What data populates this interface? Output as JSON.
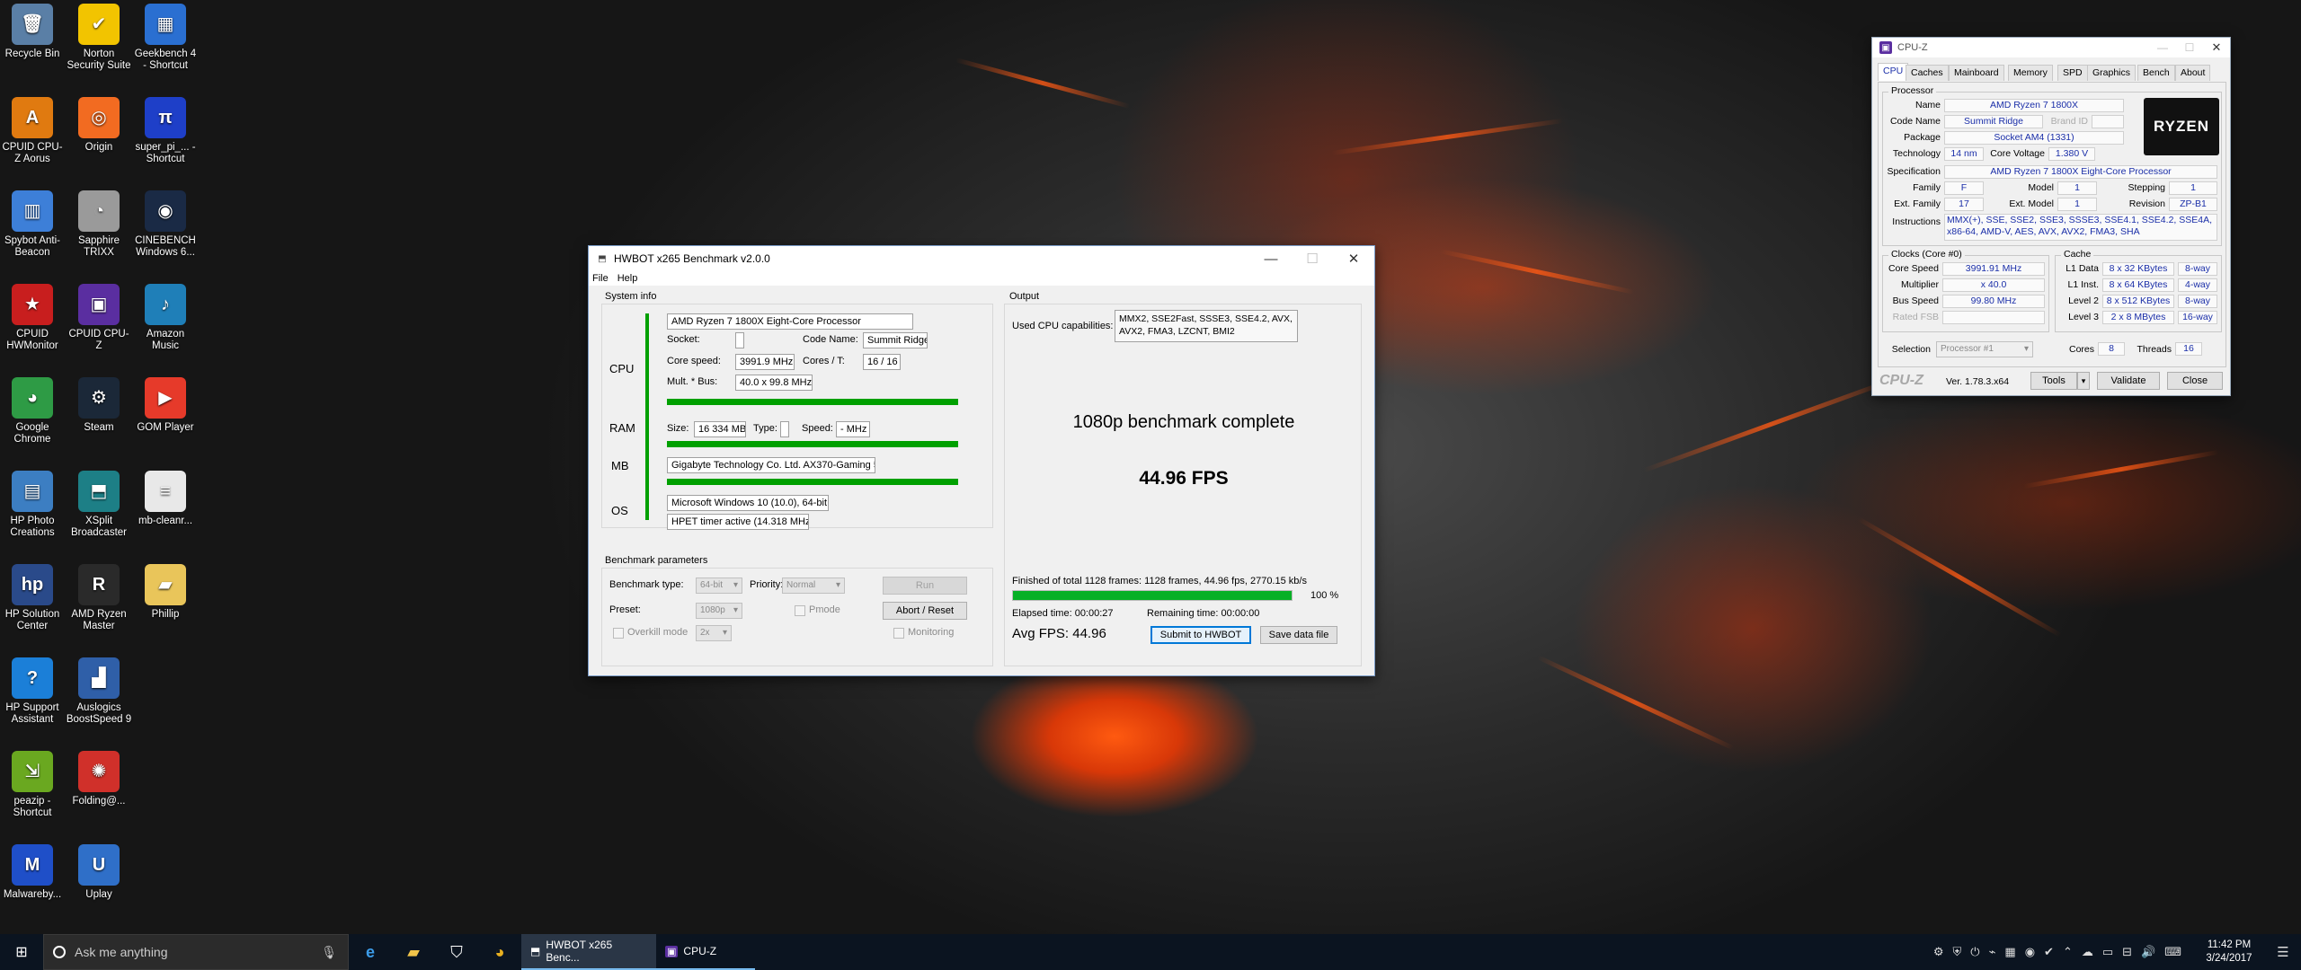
{
  "desktop": {
    "icons": [
      {
        "label": "Recycle Bin",
        "color": "#5a7fa6",
        "glyph": "🗑"
      },
      {
        "label": "Norton Security Suite",
        "color": "#f2c400",
        "glyph": "✔"
      },
      {
        "label": "Geekbench 4 - Shortcut",
        "color": "#2a6fd1",
        "glyph": "▦"
      },
      {
        "label": "CPUID CPU-Z Aorus",
        "color": "#e07a10",
        "glyph": "A"
      },
      {
        "label": "Origin",
        "color": "#f26b21",
        "glyph": "◎"
      },
      {
        "label": "super_pi_... - Shortcut",
        "color": "#1e3fc8",
        "glyph": "π"
      },
      {
        "label": "Spybot Anti-Beacon",
        "color": "#3d7fd8",
        "glyph": "▥"
      },
      {
        "label": "Sapphire TRIXX",
        "color": "#9a9a9a",
        "glyph": "◔"
      },
      {
        "label": "CINEBENCH Windows 6...",
        "color": "#1a2a45",
        "glyph": "◉"
      },
      {
        "label": "CPUID HWMonitor",
        "color": "#c81e1e",
        "glyph": "★"
      },
      {
        "label": "CPUID CPU-Z",
        "color": "#5a2ea0",
        "glyph": "▣"
      },
      {
        "label": "Amazon Music",
        "color": "#1f7fb8",
        "glyph": "♪"
      },
      {
        "label": "Google Chrome",
        "color": "#2e9b45",
        "glyph": "◕"
      },
      {
        "label": "Steam",
        "color": "#1b2838",
        "glyph": "⚙"
      },
      {
        "label": "GOM Player",
        "color": "#e63a2a",
        "glyph": "▶"
      },
      {
        "label": "HP Photo Creations",
        "color": "#3c7ec2",
        "glyph": "▤"
      },
      {
        "label": "XSplit Broadcaster",
        "color": "#1d7f86",
        "glyph": "⬒"
      },
      {
        "label": "mb-cleanr...",
        "color": "#e8e8e8",
        "glyph": "≡"
      },
      {
        "label": "HP Solution Center",
        "color": "#2a4a8a",
        "glyph": "hp"
      },
      {
        "label": "AMD Ryzen Master",
        "color": "#2a2a2a",
        "glyph": "R"
      },
      {
        "label": "Phillip",
        "color": "#e9c55a",
        "glyph": "▰"
      },
      {
        "label": "HP Support Assistant",
        "color": "#1b7fd8",
        "glyph": "?"
      },
      {
        "label": "Auslogics BoostSpeed 9",
        "color": "#2f5fa8",
        "glyph": "▟"
      },
      {
        "label": "",
        "color": "#000000",
        "glyph": ""
      },
      {
        "label": "peazip - Shortcut",
        "color": "#6aa820",
        "glyph": "⇲"
      },
      {
        "label": "Folding@...",
        "color": "#d0302a",
        "glyph": "✺"
      },
      {
        "label": "",
        "color": "#000000",
        "glyph": ""
      },
      {
        "label": "Malwareby...",
        "color": "#1f4fc8",
        "glyph": "M"
      },
      {
        "label": "Uplay",
        "color": "#2f6fc8",
        "glyph": "U"
      }
    ]
  },
  "hwbot": {
    "title": "HWBOT x265 Benchmark v2.0.0",
    "menu": [
      "File",
      "Help"
    ],
    "system_info": {
      "title": "System info",
      "cpu_label": "CPU",
      "cpu_name": "AMD Ryzen 7 1800X Eight-Core Processor",
      "socket_label": "Socket:",
      "socket_value": "",
      "codename_label": "Code Name:",
      "codename_value": "Summit Ridge",
      "corespeed_label": "Core speed:",
      "corespeed_value": "3991.9 MHz",
      "cores_label": "Cores / T:",
      "cores_value": "16 / 16",
      "mult_label": "Mult. * Bus:",
      "mult_value": "40.0 x 99.8 MHz",
      "ram_label": "RAM",
      "size_label": "Size:",
      "size_value": "16 334 MB",
      "type_label": "Type:",
      "type_value": "",
      "speed_label": "Speed:",
      "speed_value": "- MHz",
      "mb_label": "MB",
      "mb_value": "Gigabyte Technology Co. Ltd. AX370-Gaming 5",
      "os_label": "OS",
      "os_value": "Microsoft Windows 10 (10.0), 64-bit",
      "timer_value": "HPET timer active (14.318 MHz )"
    },
    "bench_params": {
      "title": "Benchmark parameters",
      "type_label": "Benchmark type:",
      "type_value": "64-bit",
      "priority_label": "Priority:",
      "priority_value": "Normal",
      "run_label": "Run",
      "preset_label": "Preset:",
      "preset_value": "1080p",
      "pmode_label": "Pmode",
      "abort_label": "Abort / Reset",
      "overkill_label": "Overkill mode",
      "overkill_value": "2x",
      "monitoring_label": "Monitoring"
    },
    "output": {
      "title": "Output",
      "caps_label": "Used CPU capabilities:",
      "caps_value": "MMX2, SSE2Fast, SSSE3, SSE4.2, AVX, AVX2, FMA3, LZCNT, BMI2",
      "complete_text": "1080p benchmark complete",
      "fps_text": "44.96 FPS",
      "finished_text": "Finished of total 1128 frames: 1128 frames, 44.96 fps,  2770.15 kb/s",
      "progress_pct": "100 %",
      "progress_fraction": 1.0,
      "elapsed_text": "Elapsed time: 00:00:27",
      "remaining_text": "Remaining time: 00:00:00",
      "avg_fps_text": "Avg FPS: 44.96",
      "submit_label": "Submit to HWBOT",
      "save_label": "Save data file"
    }
  },
  "cpuz": {
    "title": "CPU-Z",
    "tabs": [
      "CPU",
      "Caches",
      "Mainboard",
      "Memory",
      "SPD",
      "Graphics",
      "Bench",
      "About"
    ],
    "processor": {
      "title": "Processor",
      "name_label": "Name",
      "name_value": "AMD Ryzen 7 1800X",
      "codename_label": "Code Name",
      "codename_value": "Summit Ridge",
      "brandid_label": "Brand ID",
      "package_label": "Package",
      "package_value": "Socket AM4 (1331)",
      "tech_label": "Technology",
      "tech_value": "14 nm",
      "voltage_label": "Core Voltage",
      "voltage_value": "1.380 V",
      "spec_label": "Specification",
      "spec_value": "AMD Ryzen 7 1800X Eight-Core Processor",
      "family_label": "Family",
      "family_value": "F",
      "model_label": "Model",
      "model_value": "1",
      "stepping_label": "Stepping",
      "stepping_value": "1",
      "extfamily_label": "Ext. Family",
      "extfamily_value": "17",
      "extmodel_label": "Ext. Model",
      "extmodel_value": "1",
      "revision_label": "Revision",
      "revision_value": "ZP-B1",
      "instr_label": "Instructions",
      "instr_value": "MMX(+), SSE, SSE2, SSE3, SSSE3, SSE4.1, SSE4.2, SSE4A, x86-64, AMD-V, AES, AVX, AVX2, FMA3, SHA",
      "logo_text": "RYZEN"
    },
    "clocks": {
      "title": "Clocks (Core #0)",
      "corespeed_label": "Core Speed",
      "corespeed_value": "3991.91 MHz",
      "multiplier_label": "Multiplier",
      "multiplier_value": "x 40.0",
      "busspeed_label": "Bus Speed",
      "busspeed_value": "99.80 MHz",
      "ratedfsb_label": "Rated FSB"
    },
    "cache": {
      "title": "Cache",
      "rows": [
        {
          "label": "L1 Data",
          "size": "8 x 32 KBytes",
          "way": "8-way"
        },
        {
          "label": "L1 Inst.",
          "size": "8 x 64 KBytes",
          "way": "4-way"
        },
        {
          "label": "Level 2",
          "size": "8 x 512 KBytes",
          "way": "8-way"
        },
        {
          "label": "Level 3",
          "size": "2 x 8 MBytes",
          "way": "16-way"
        }
      ]
    },
    "selection_label": "Selection",
    "selection_value": "Processor #1",
    "cores_label": "Cores",
    "cores_value": "8",
    "threads_label": "Threads",
    "threads_value": "16",
    "brand": "CPU-Z",
    "version": "Ver. 1.78.3.x64",
    "tools_label": "Tools",
    "validate_label": "Validate",
    "close_label": "Close"
  },
  "taskbar": {
    "search_placeholder": "Ask me anything",
    "apps": [
      {
        "label": "HWBOT x265 Benc..."
      },
      {
        "label": "CPU-Z"
      }
    ],
    "time": "11:42 PM",
    "date": "3/24/2017"
  }
}
